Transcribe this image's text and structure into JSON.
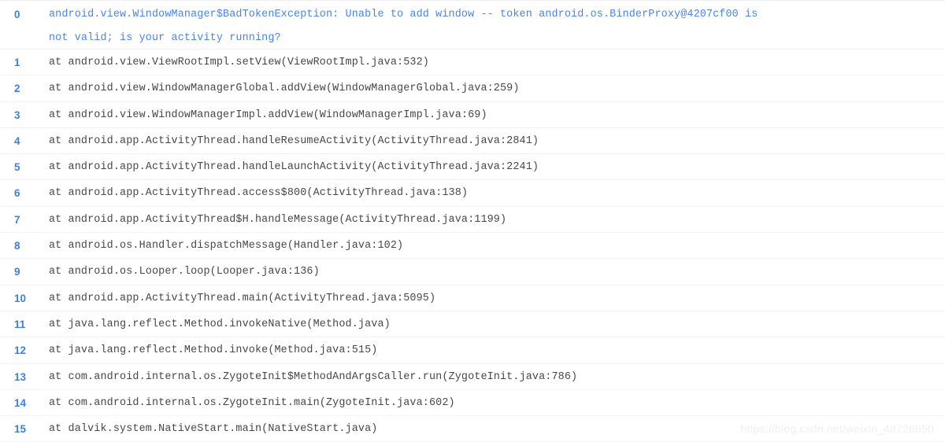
{
  "viewer": {
    "type": "stack-trace-code-block",
    "language": "java",
    "accent_color": "#4a84e8",
    "line_number_color": "#3f7fe0",
    "text_color": "#474747",
    "background_color": "#ffffff",
    "divider_color": "#f2f3f5"
  },
  "lines": [
    {
      "number": "0",
      "kind": "exception",
      "text": "android.view.WindowManager$BadTokenException: Unable to add window -- token android.os.BinderProxy@4207cf00 is not valid; is your activity running?",
      "segments": [
        "android.view.WindowManager$BadTokenException: Unable to add window -- token android.os.BinderProxy@4207cf00 is",
        "not valid; is your activity running?"
      ]
    },
    {
      "number": "1",
      "kind": "frame",
      "text": "at android.view.ViewRootImpl.setView(ViewRootImpl.java:532)"
    },
    {
      "number": "2",
      "kind": "frame",
      "text": "at android.view.WindowManagerGlobal.addView(WindowManagerGlobal.java:259)"
    },
    {
      "number": "3",
      "kind": "frame",
      "text": "at android.view.WindowManagerImpl.addView(WindowManagerImpl.java:69)"
    },
    {
      "number": "4",
      "kind": "frame",
      "text": "at android.app.ActivityThread.handleResumeActivity(ActivityThread.java:2841)"
    },
    {
      "number": "5",
      "kind": "frame",
      "text": "at android.app.ActivityThread.handleLaunchActivity(ActivityThread.java:2241)"
    },
    {
      "number": "6",
      "kind": "frame",
      "text": "at android.app.ActivityThread.access$800(ActivityThread.java:138)"
    },
    {
      "number": "7",
      "kind": "frame",
      "text": "at android.app.ActivityThread$H.handleMessage(ActivityThread.java:1199)"
    },
    {
      "number": "8",
      "kind": "frame",
      "text": "at android.os.Handler.dispatchMessage(Handler.java:102)"
    },
    {
      "number": "9",
      "kind": "frame",
      "text": "at android.os.Looper.loop(Looper.java:136)"
    },
    {
      "number": "10",
      "kind": "frame",
      "text": "at android.app.ActivityThread.main(ActivityThread.java:5095)"
    },
    {
      "number": "11",
      "kind": "frame",
      "text": "at java.lang.reflect.Method.invokeNative(Method.java)"
    },
    {
      "number": "12",
      "kind": "frame",
      "text": "at java.lang.reflect.Method.invoke(Method.java:515)"
    },
    {
      "number": "13",
      "kind": "frame",
      "text": "at com.android.internal.os.ZygoteInit$MethodAndArgsCaller.run(ZygoteInit.java:786)"
    },
    {
      "number": "14",
      "kind": "frame",
      "text": "at com.android.internal.os.ZygoteInit.main(ZygoteInit.java:602)"
    },
    {
      "number": "15",
      "kind": "frame",
      "text": "at dalvik.system.NativeStart.main(NativeStart.java)"
    }
  ],
  "watermark": {
    "text": "https://blog.csdn.net/weixin_48726650"
  }
}
